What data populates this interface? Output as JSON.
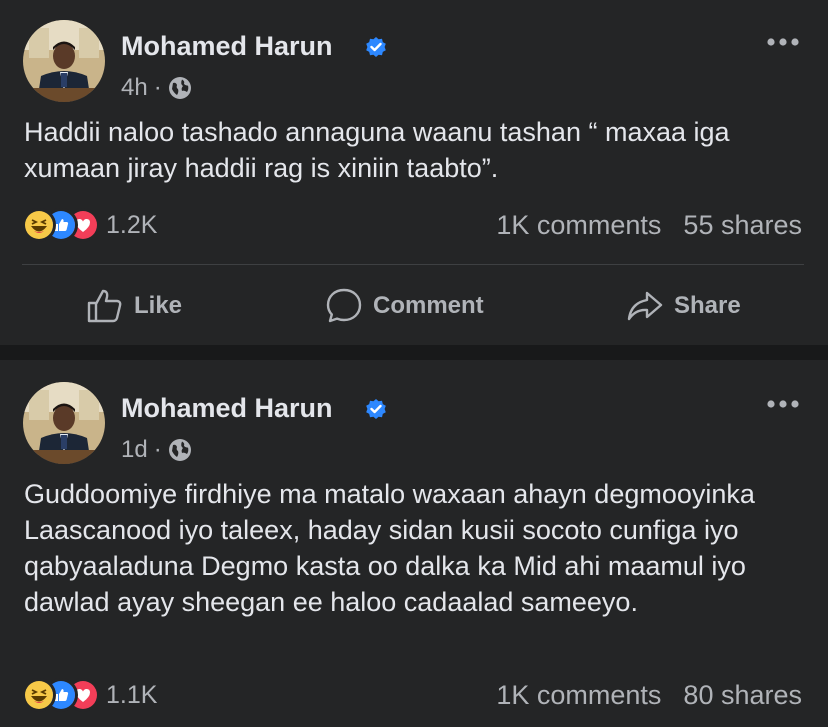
{
  "posts": [
    {
      "author": "Mohamed Harun",
      "time": "4h",
      "separator": "·",
      "text": "Haddii naloo tashado annaguna waanu tashan “ maxaa iga xumaan jiray haddii rag is xiniin taabto”.",
      "reactions_count": "1.2K",
      "comments": "1K comments",
      "shares": "55 shares"
    },
    {
      "author": "Mohamed Harun",
      "time": "1d",
      "separator": "·",
      "text": "Guddoomiye firdhiye ma matalo waxaan ahayn degmooyinka Laascanood iyo taleex, haday sidan kusii socoto cunfiga iyo qabyaaladuna  Degmo kasta oo dalka ka Mid ahi maamul iyo dawlad ayay sheegan ee haloo cadaalad sameeyo.",
      "reactions_count": "1.1K",
      "comments": "1K comments",
      "shares": "80 shares"
    }
  ],
  "actions": {
    "like": "Like",
    "comment": "Comment",
    "share": "Share"
  },
  "icons": {
    "verified": "verified-badge-icon",
    "privacy": "globe-icon",
    "more": "more-options-icon",
    "reactions": [
      "haha-icon",
      "like-reaction-icon",
      "love-icon"
    ]
  },
  "colors": {
    "background": "#18191a",
    "card": "#242526",
    "accent": "#2d88ff",
    "text": "#e4e6eb",
    "secondary": "#b0b3b8"
  }
}
